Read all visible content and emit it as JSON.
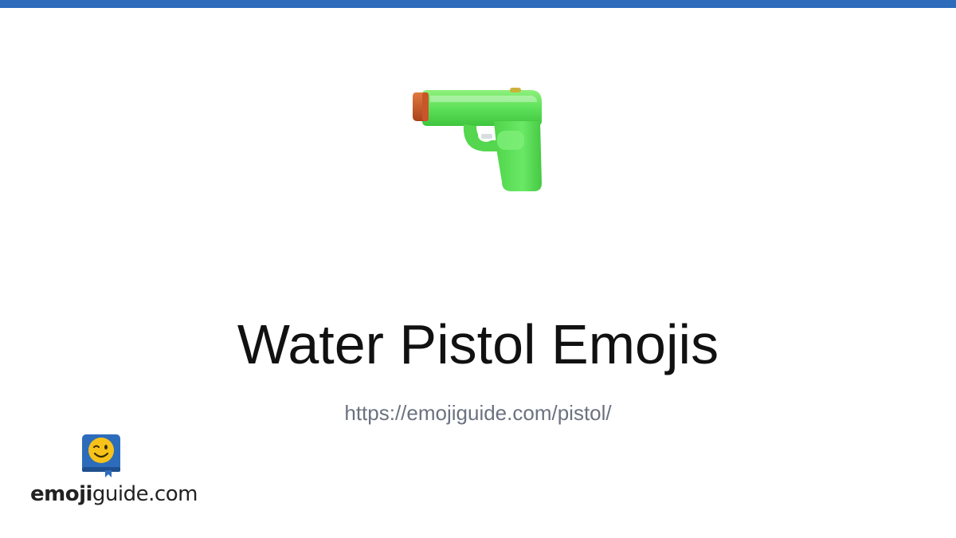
{
  "colors": {
    "top_bar": "#2d6cbb",
    "title": "#111111",
    "url": "#6b7280",
    "gun_body": "#5ee15a",
    "gun_nozzle": "#c8562a",
    "logo_book": "#2d6cbb",
    "logo_face": "#f7c21a"
  },
  "hero": {
    "emoji_icon": "water-pistol-icon",
    "title": "Water Pistol Emojis",
    "url": "https://emojiguide.com/pistol/"
  },
  "logo": {
    "icon": "winking-face-book-icon",
    "name_bold": "emoji",
    "name_regular": "guide.com"
  }
}
